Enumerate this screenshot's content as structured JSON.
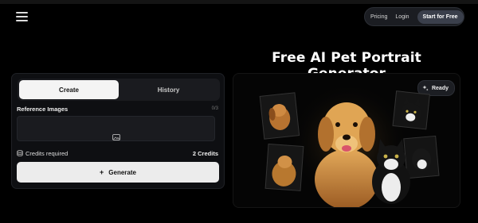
{
  "header": {
    "menu_icon": "hamburger-icon",
    "nav": {
      "pricing": "Pricing",
      "login": "Login",
      "cta": "Start for Free"
    }
  },
  "hero": {
    "title": "Free AI Pet Portrait Generator"
  },
  "panel": {
    "tabs": [
      {
        "label": "Create",
        "active": true
      },
      {
        "label": "History",
        "active": false
      }
    ],
    "reference_label": "Reference Images",
    "reference_count": "0/3",
    "upload_icon": "image-icon",
    "credits_icon": "coins-icon",
    "credits_label": "Credits required",
    "credits_value": "2 Credits",
    "generate_label": "Generate",
    "generate_icon": "plus-icon"
  },
  "preview": {
    "status": "Ready",
    "status_icon": "sparkle-icon",
    "image_alt": "Collage of golden retrievers and black-and-white cats"
  },
  "colors": {
    "background": "#000000",
    "panel": "#0e0f12",
    "button_light": "#ececec",
    "nav_bg": "#1b1d22"
  }
}
